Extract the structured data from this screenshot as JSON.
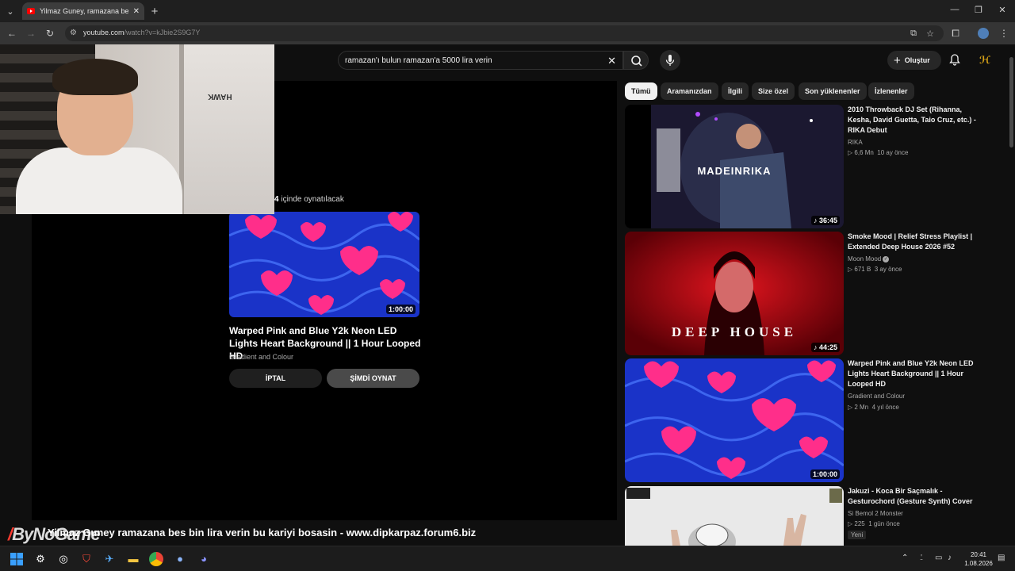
{
  "browser": {
    "tab_title": "Yilmaz Guney, ramazana bes bin lira verin...",
    "url_host": "youtube.com",
    "url_path": "/watch?v=kJbie2S9G7Y"
  },
  "youtube": {
    "search_query": "ramazan'ı bulun ramazan'a 5000 lira verin",
    "create_label": "Oluştur",
    "chips": [
      "Tümü",
      "Aramanızdan",
      "İlgili",
      "Size özel",
      "Son yüklenenler",
      "İzlenenler"
    ],
    "player": {
      "upnext_prefix": "",
      "upnext_count": "4",
      "upnext_suffix": "içinde oynatılacak",
      "upnext_title": "Warped Pink and Blue Y2k Neon LED Lights Heart Background || 1 Hour Looped HD",
      "upnext_channel": "Gradient and Colour",
      "upnext_duration": "1:00:00",
      "cancel_label": "İPTAL",
      "play_now_label": "ŞİMDİ OYNAT"
    },
    "recommendations": [
      {
        "title": "2010 Throwback DJ Set (Rihanna, Kesha, David Guetta, Taio Cruz, etc.) - RIKA Debut",
        "channel": "RIKA",
        "views": "6,6 Mn",
        "age": "10 ay önce",
        "duration": "36:45",
        "thumb_text": "MADEINRIKA"
      },
      {
        "title": "Smoke Mood | Relief Stress Playlist | Extended Deep House 2026 #52",
        "channel": "Moon Mood",
        "views": "671 B",
        "age": "3 ay önce",
        "duration": "44:25",
        "thumb_text": "DEEP HOUSE"
      },
      {
        "title": "Warped Pink and Blue Y2k Neon LED Lights Heart Background || 1 Hour Looped HD",
        "channel": "Gradient and Colour",
        "views": "2 Mn",
        "age": "4 yıl önce",
        "duration": "1:00:00",
        "thumb_text": ""
      },
      {
        "title": "Jakuzi - Koca Bir Saçmalık - Gesturochord (Gesture Synth) Cover",
        "channel": "Si Bemol 2 Monster",
        "views": "225",
        "age": "1 gün önce",
        "badge": "Yeni"
      }
    ]
  },
  "overlay": {
    "webcam_label": "HAWK",
    "ticker": "Yilmaz Guney ramazana bes bin lira verin bu kariyi bosasin - www.dipkarpaz.forum6.biz",
    "watermark": "ByNoGame"
  },
  "taskbar": {
    "time": "20:41",
    "date": "1.08.2026"
  }
}
